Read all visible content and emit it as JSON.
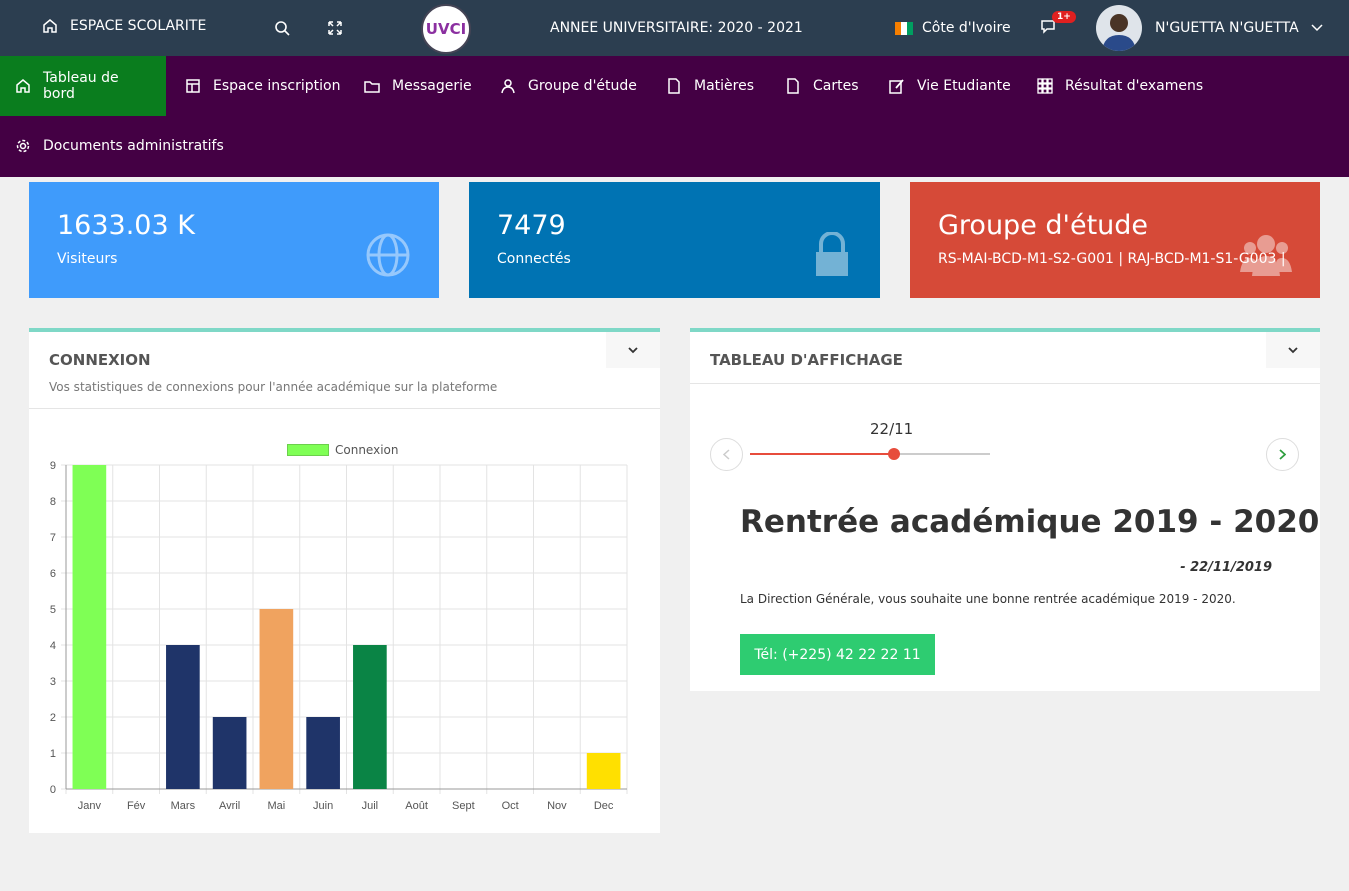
{
  "topbar": {
    "home_label": "ESPACE SCOLARITE",
    "logo_text": "UVCI",
    "year_label": "ANNEE UNIVERSITAIRE: 2020 - 2021",
    "country": "Côte d'Ivoire",
    "notif_count": "1+",
    "user_name": "N'GUETTA N'GUETTA"
  },
  "nav": {
    "items": [
      {
        "label": "Tableau de bord",
        "icon": "home-icon"
      },
      {
        "label": "Espace inscription",
        "icon": "layout-icon"
      },
      {
        "label": "Messagerie",
        "icon": "folder-icon"
      },
      {
        "label": "Groupe d'étude",
        "icon": "user-icon"
      },
      {
        "label": "Matières",
        "icon": "file-icon"
      },
      {
        "label": "Cartes",
        "icon": "file-icon"
      },
      {
        "label": "Vie Etudiante",
        "icon": "edit-icon"
      },
      {
        "label": "Résultat d'examens",
        "icon": "grid-icon"
      },
      {
        "label": "Documents administratifs",
        "icon": "gear-icon"
      }
    ]
  },
  "stats": [
    {
      "value": "1633.03 K",
      "label": "Visiteurs",
      "color": "#3f9bfb",
      "icon": "globe-icon"
    },
    {
      "value": "7479",
      "label": "Connectés",
      "color": "#0073b3",
      "icon": "lock-icon"
    },
    {
      "value": "Groupe d'étude",
      "label": "RS-MAI-BCD-M1-S2-G001 | RAJ-BCD-M1-S1-G003 |",
      "color": "#d64a38",
      "icon": "users-icon"
    }
  ],
  "connexion": {
    "title": "CONNEXION",
    "subtitle": "Vos statistiques de connexions pour l'année académique sur la plateforme"
  },
  "chart_data": {
    "type": "bar",
    "categories": [
      "Janv",
      "Fév",
      "Mars",
      "Avril",
      "Mai",
      "Juin",
      "Juil",
      "Août",
      "Sept",
      "Oct",
      "Nov",
      "Dec"
    ],
    "values": [
      9,
      0,
      4,
      2,
      5,
      2,
      4,
      0,
      0,
      0,
      0,
      1
    ],
    "colors": [
      "#7fff55",
      "#1f3469",
      "#1f3469",
      "#1f3469",
      "#f0a35f",
      "#1f3469",
      "#0a8445",
      "#1f3469",
      "#1f3469",
      "#1f3469",
      "#1f3469",
      "#ffe000"
    ],
    "series": [
      {
        "name": "Connexion",
        "values": [
          9,
          0,
          4,
          2,
          5,
          2,
          4,
          0,
          0,
          0,
          0,
          1
        ]
      }
    ],
    "ylim": [
      0,
      9
    ],
    "yticks": [
      "0",
      "1",
      "2",
      "3",
      "4",
      "5",
      "6",
      "7",
      "8",
      "9"
    ],
    "grid": true,
    "legend": "top-center"
  },
  "board": {
    "title": "TABLEAU D'AFFICHAGE",
    "date_label": "22/11",
    "slider_value": 0.6,
    "ann_title": "Rentrée académique 2019 - 2020",
    "ann_date": "- 22/11/2019",
    "ann_text": "La Direction Générale, vous souhaite une bonne rentrée académique 2019 - 2020.",
    "tel_label": "Tél: (+225) 42 22 22 11"
  }
}
